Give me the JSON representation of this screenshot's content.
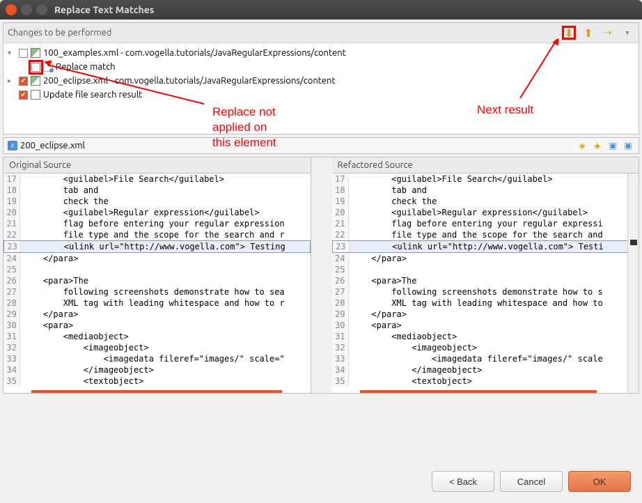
{
  "window": {
    "title": "Replace Text Matches"
  },
  "changes_section": {
    "title": "Changes to be performed",
    "tree": [
      {
        "expander": "▾",
        "checked": false,
        "icon": "file",
        "label": "100_examples.xml - com.vogella.tutorials/JavaRegularExpressions/content",
        "indent": 0
      },
      {
        "expander": "",
        "checked": false,
        "checkbox_red": true,
        "icon": "match",
        "label": "Replace match",
        "indent": 1
      },
      {
        "expander": "▸",
        "checked": true,
        "icon": "file",
        "label": "200_eclipse.xml - com.vogella.tutorials/JavaRegularExpressions/content",
        "indent": 0
      },
      {
        "expander": "",
        "checked": true,
        "icon": "update",
        "label": "Update file search result",
        "indent": 0
      }
    ]
  },
  "annotations": {
    "replace_not_applied": "Replace not\napplied on\nthis element",
    "next_result": "Next result"
  },
  "file_tab": {
    "icon_text": "X",
    "filename": "200_eclipse.xml"
  },
  "diff": {
    "left_title": "Original Source",
    "right_title": "Refactored Source",
    "left_lines": [
      {
        "n": "17",
        "t": "        <guilabel>File Search</guilabel>"
      },
      {
        "n": "18",
        "t": "        tab and"
      },
      {
        "n": "19",
        "t": "        check the"
      },
      {
        "n": "20",
        "t": "        <guilabel>Regular expression</guilabel>"
      },
      {
        "n": "21",
        "t": "        flag before entering your regular expression"
      },
      {
        "n": "22",
        "t": "        file type and the scope for the search and r"
      },
      {
        "n": "23",
        "t": "        <ulink url=\"http://www.vogella.com\"> Testing",
        "hl": true
      },
      {
        "n": "24",
        "t": "    </para>"
      },
      {
        "n": "25",
        "t": ""
      },
      {
        "n": "26",
        "t": "    <para>The"
      },
      {
        "n": "27",
        "t": "        following screenshots demonstrate how to sea"
      },
      {
        "n": "28",
        "t": "        XML tag with leading whitespace and how to r"
      },
      {
        "n": "29",
        "t": "    </para>"
      },
      {
        "n": "30",
        "t": "    <para>"
      },
      {
        "n": "31",
        "t": "        <mediaobject>"
      },
      {
        "n": "32",
        "t": "            <imageobject>"
      },
      {
        "n": "33",
        "t": "                <imagedata fileref=\"images/\" scale=\""
      },
      {
        "n": "34",
        "t": "            </imageobject>"
      },
      {
        "n": "35",
        "t": "            <textobject>"
      }
    ],
    "right_lines": [
      {
        "n": "17",
        "t": "        <guilabel>File Search</guilabel>"
      },
      {
        "n": "18",
        "t": "        tab and"
      },
      {
        "n": "19",
        "t": "        check the"
      },
      {
        "n": "20",
        "t": "        <guilabel>Regular expression</guilabel>"
      },
      {
        "n": "21",
        "t": "        flag before entering your regular expressi"
      },
      {
        "n": "22",
        "t": "        file type and the scope for the search and"
      },
      {
        "n": "23",
        "t": "        <ulink url=\"http://www.vogella.com\"> Testi",
        "hl": true
      },
      {
        "n": "24",
        "t": "    </para>"
      },
      {
        "n": "25",
        "t": ""
      },
      {
        "n": "26",
        "t": "    <para>The"
      },
      {
        "n": "27",
        "t": "        following screenshots demonstrate how to s"
      },
      {
        "n": "28",
        "t": "        XML tag with leading whitespace and how to"
      },
      {
        "n": "29",
        "t": "    </para>"
      },
      {
        "n": "30",
        "t": "    <para>"
      },
      {
        "n": "31",
        "t": "        <mediaobject>"
      },
      {
        "n": "32",
        "t": "            <imageobject>"
      },
      {
        "n": "33",
        "t": "                <imagedata fileref=\"images/\" scale"
      },
      {
        "n": "34",
        "t": "            </imageobject>"
      },
      {
        "n": "35",
        "t": "            <textobject>"
      }
    ]
  },
  "buttons": {
    "back": "< Back",
    "cancel": "Cancel",
    "ok": "OK"
  }
}
